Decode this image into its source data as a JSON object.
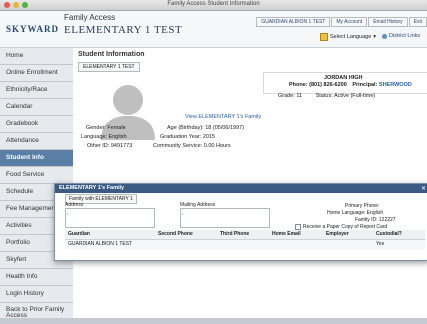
{
  "window": {
    "title": "Family Access Student Information"
  },
  "header": {
    "family_access": "Family Access",
    "school": "ELEMENTARY 1 TEST",
    "logo": "SKYWARD",
    "links": [
      "GUARDIAN ALBION 1 TEST",
      "My Account",
      "Email History",
      "Exit"
    ],
    "select_language": "Select Language",
    "district_links": "District Links"
  },
  "sidebar": {
    "items": [
      "Home",
      "Online Enrollment",
      "Ethnicity/Race",
      "Calendar",
      "Gradebook",
      "Attendance",
      "Student Info",
      "Food Service",
      "Schedule",
      "Fee Management",
      "Activities",
      "Portfolio",
      "Skyfert",
      "Health Info",
      "Login History",
      "Back to Prior Family Access"
    ],
    "active": "Student Info"
  },
  "student_info": {
    "title": "Student Information",
    "tab": "ELEMENTARY 1 TEST",
    "comma": ",",
    "school_name": "JORDAN HIGH",
    "phone_label": "Phone:",
    "phone": "(801) 826-6200",
    "principal_label": "Principal:",
    "principal": "SHERWOOD",
    "grade_label": "Grade:",
    "grade": "11",
    "status_label": "Status:",
    "status": "Active (Full-time)",
    "view_family": "View ELEMENTARY 1's Family",
    "gender_label": "Gender:",
    "gender": "Female",
    "language_label": "Language:",
    "language": "English",
    "otherid_label": "Other ID:",
    "otherid": "9491773",
    "age_label": "Age (Birthday):",
    "age": "18 (05/06/1997)",
    "gradyear_label": "Graduation Year:",
    "gradyear": "2015",
    "service_label": "Community Service:",
    "service": "0.00 Hours"
  },
  "family_modal": {
    "title": "ELEMENTARY 1's Family",
    "tab": "Family with ELEMENTARY 1",
    "address_label": "Address",
    "mailing_label": "Mailing Address",
    "address_value": ",",
    "mailing_value": ",",
    "primary_phone": "Primary Phone:",
    "home_language": "Home Language: English",
    "family_id": "Family ID: 122227",
    "receive_paper": "Receive a Paper Copy of Report Card",
    "columns": [
      "Guardian",
      "Second Phone",
      "Third Phone",
      "Home Email",
      "Employer",
      "Custodial?"
    ],
    "rows": [
      [
        "GUARDIAN ALBION 1 TEST",
        "",
        "",
        "",
        "",
        "Yes"
      ]
    ]
  }
}
